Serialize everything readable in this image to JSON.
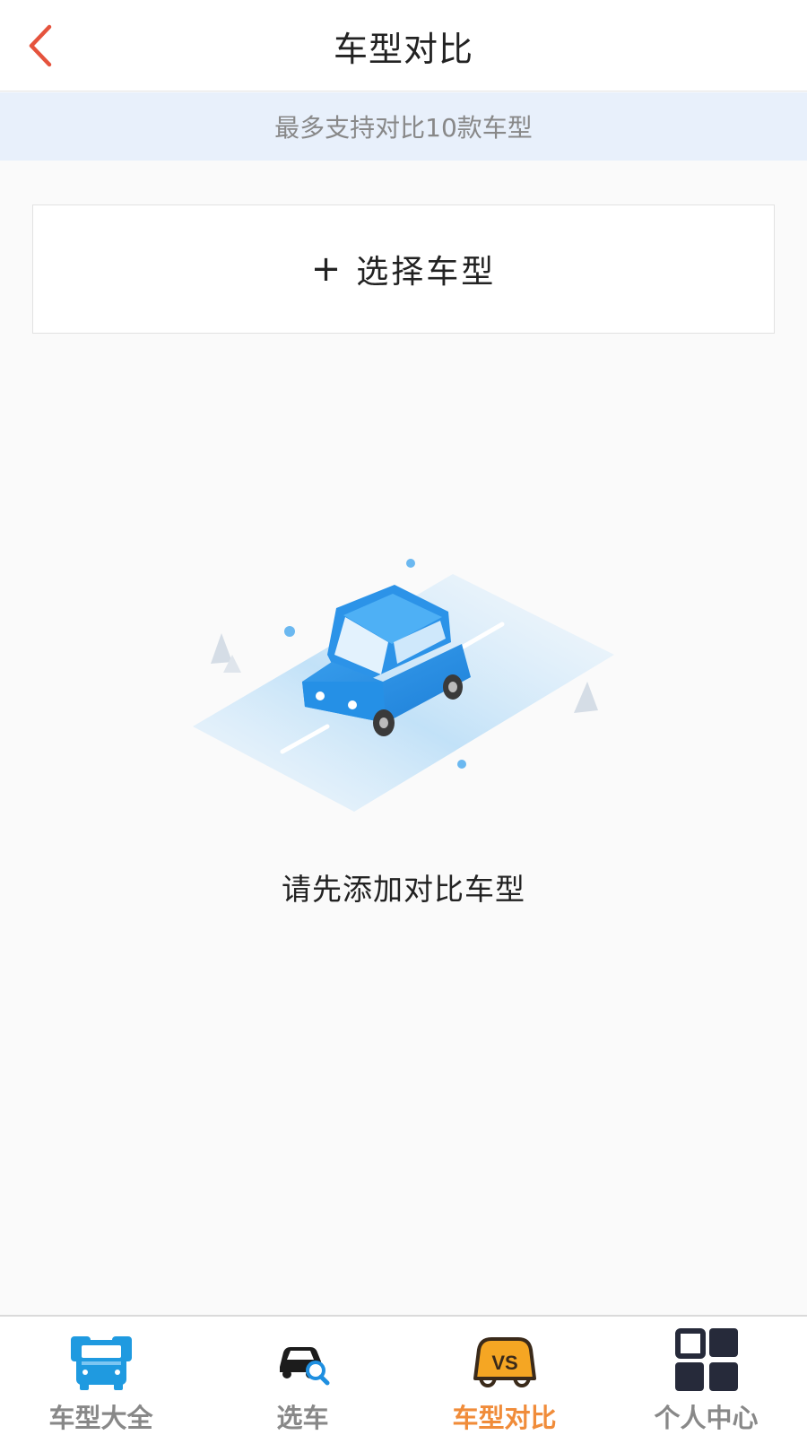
{
  "header": {
    "title": "车型对比",
    "back_icon": "chevron-left-icon",
    "back_color": "#e5533d"
  },
  "notice": {
    "text": "最多支持对比10款车型"
  },
  "select_button": {
    "plus": "+",
    "label": "选择车型"
  },
  "empty_state": {
    "illustration": "car-on-road-illustration",
    "message": "请先添加对比车型"
  },
  "tabbar": {
    "active_index": 2,
    "active_color": "#f08c3a",
    "inactive_color": "#888888",
    "items": [
      {
        "label": "车型大全",
        "icon": "car-fleet-icon"
      },
      {
        "label": "选车",
        "icon": "car-search-icon"
      },
      {
        "label": "车型对比",
        "icon": "car-vs-icon"
      },
      {
        "label": "个人中心",
        "icon": "grid-apps-icon"
      }
    ]
  }
}
